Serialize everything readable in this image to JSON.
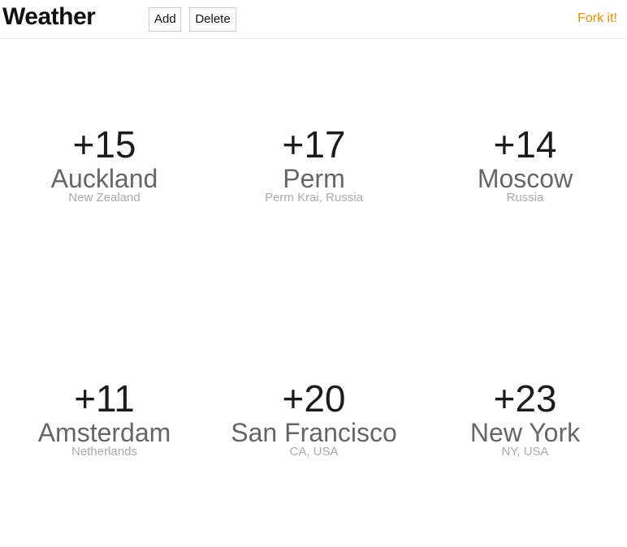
{
  "header": {
    "title": "Weather",
    "add_label": "Add",
    "delete_label": "Delete",
    "fork_label": "Fork it!"
  },
  "colors": {
    "accent": "#f08a00",
    "temp_text": "#1c1c1c",
    "city_text": "#666666",
    "region_text": "#aaaaaa"
  },
  "cities": [
    {
      "temp": "+15",
      "name": "Auckland",
      "region": "New Zealand"
    },
    {
      "temp": "+17",
      "name": "Perm",
      "region": "Perm Krai, Russia"
    },
    {
      "temp": "+14",
      "name": "Moscow",
      "region": "Russia"
    },
    {
      "temp": "+11",
      "name": "Amsterdam",
      "region": "Netherlands"
    },
    {
      "temp": "+20",
      "name": "San Francisco",
      "region": "CA, USA"
    },
    {
      "temp": "+23",
      "name": "New York",
      "region": "NY, USA"
    }
  ]
}
